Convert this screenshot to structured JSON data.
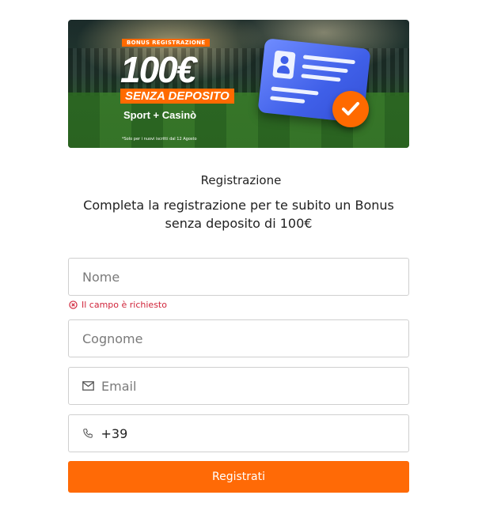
{
  "banner": {
    "tag": "BONUS REGISTRAZIONE",
    "amount": "100€",
    "no_deposit": "SENZA DEPOSITO",
    "products": "Sport + Casinò",
    "note": "*Solo per i nuovi iscritti dal 12 Agosto",
    "card_icon": "id-card-icon",
    "badge_icon": "check-icon"
  },
  "form": {
    "title": "Registrazione",
    "subtitle": "Completa la registrazione per te subito un Bonus senza deposito di 100€",
    "fields": {
      "nome": {
        "placeholder": "Nome",
        "value": ""
      },
      "nome_error": "Il campo è richiesto",
      "cognome": {
        "placeholder": "Cognome",
        "value": ""
      },
      "email": {
        "placeholder": "Email",
        "value": "",
        "icon": "mail-icon"
      },
      "phone": {
        "placeholder": "",
        "value": "+39",
        "icon": "phone-icon"
      }
    },
    "submit_label": "Registrati"
  },
  "colors": {
    "accent": "#ff6a06",
    "error": "#d0243a",
    "border": "#cfcfcf",
    "card_blue": "#3f5fe8"
  }
}
